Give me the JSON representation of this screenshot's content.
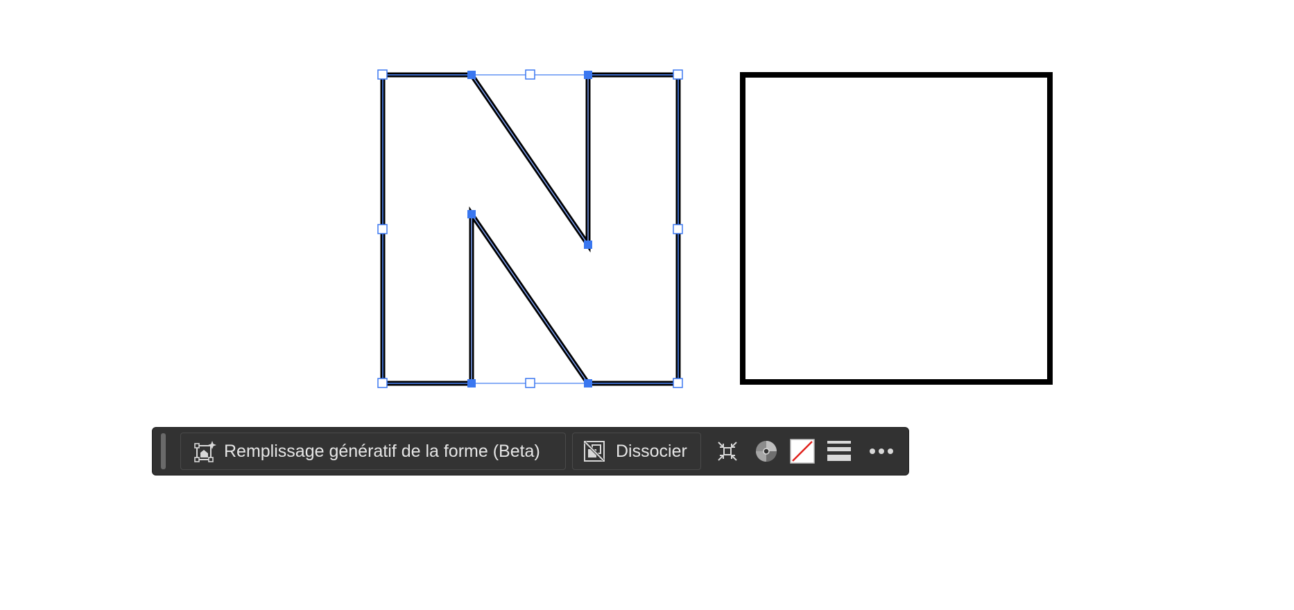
{
  "canvas": {
    "selected_artwork": "letter-N-outline",
    "other_artwork": "square-outline",
    "selection_color": "#3a77f0",
    "stroke_color": "#000000"
  },
  "contextual_taskbar": {
    "generative_fill_label": "Remplissage génératif de la forme (Beta)",
    "ungroup_label": "Dissocier",
    "icons": [
      "generative-shape-fill-icon",
      "ungroup-icon",
      "collapse-icon",
      "recolor-icon",
      "no-fill-swatch-icon",
      "stroke-weight-icon",
      "more-options-icon"
    ],
    "background": "#323232",
    "text_color": "#e6e6e6"
  }
}
